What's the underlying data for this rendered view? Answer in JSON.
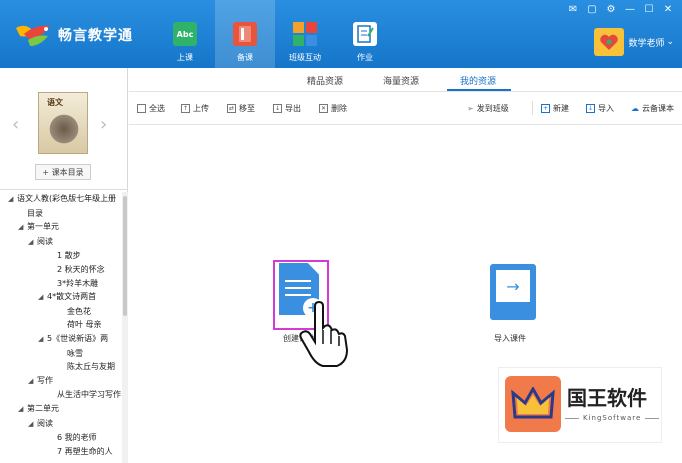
{
  "app": {
    "name": "畅言教学通",
    "colors": {
      "header": "#1a7fd6",
      "accent": "#1a73c9",
      "highlight": "#d43bd4"
    }
  },
  "window_controls": [
    "mail-icon",
    "chat-icon",
    "settings-icon",
    "minimize-icon",
    "maximize-icon",
    "close-icon"
  ],
  "nav": [
    {
      "label": "上课",
      "icon": "abc-icon",
      "icon_text": "Abc",
      "color": "#2fb36a",
      "active": false
    },
    {
      "label": "备课",
      "icon": "book-icon",
      "icon_text": "",
      "color": "#e8553d",
      "active": true
    },
    {
      "label": "班级互动",
      "icon": "blocks-icon",
      "icon_text": "",
      "color": "#f2a12b",
      "active": false
    },
    {
      "label": "作业",
      "icon": "homework-icon",
      "icon_text": "",
      "color": "#ffffff",
      "active": false
    }
  ],
  "user": {
    "name": "数学老师",
    "dropdown": "⌄"
  },
  "sidebar": {
    "book_cover_title": "语文",
    "toc_button": "+ 课本目录",
    "tree": [
      {
        "level": 0,
        "toggle": "◢",
        "text": "语文人教(彩色版七年级上册"
      },
      {
        "level": 1,
        "toggle": "",
        "text": "目录"
      },
      {
        "level": 1,
        "toggle": "◢",
        "text": "第一单元"
      },
      {
        "level": 2,
        "toggle": "◢",
        "text": "阅读"
      },
      {
        "level": 4,
        "toggle": "",
        "text": "1 散步"
      },
      {
        "level": 4,
        "toggle": "",
        "text": "2 秋天的怀念"
      },
      {
        "level": 4,
        "toggle": "",
        "text": "3*羚羊木雕"
      },
      {
        "level": 3,
        "toggle": "◢",
        "text": "4*散文诗两首"
      },
      {
        "level": 5,
        "toggle": "",
        "text": "金色花"
      },
      {
        "level": 5,
        "toggle": "",
        "text": "荷叶 母亲"
      },
      {
        "level": 3,
        "toggle": "◢",
        "text": "5《世说新语》两"
      },
      {
        "level": 5,
        "toggle": "",
        "text": "咏雪"
      },
      {
        "level": 5,
        "toggle": "",
        "text": "陈太丘与友期"
      },
      {
        "level": 2,
        "toggle": "◢",
        "text": "写作"
      },
      {
        "level": 4,
        "toggle": "",
        "text": "从生活中学习写作"
      },
      {
        "level": 1,
        "toggle": "◢",
        "text": "第二单元"
      },
      {
        "level": 2,
        "toggle": "◢",
        "text": "阅读"
      },
      {
        "level": 4,
        "toggle": "",
        "text": "6 我的老师"
      },
      {
        "level": 4,
        "toggle": "",
        "text": "7 再塑生命的人"
      }
    ]
  },
  "tabs": [
    {
      "label": "精品资源",
      "active": false
    },
    {
      "label": "海量资源",
      "active": false
    },
    {
      "label": "我的资源",
      "active": true
    }
  ],
  "toolbar": {
    "select_all": "全选",
    "upload": "上传",
    "move": "移至",
    "export": "导出",
    "delete": "删除",
    "send_class": "发到班级",
    "new": "新建",
    "import": "导入",
    "cloud": "云备课本"
  },
  "main": {
    "create_label": "创建课件",
    "import_label": "导入课件"
  },
  "watermark": {
    "title": "国王软件",
    "subtitle": "KingSoftware"
  }
}
